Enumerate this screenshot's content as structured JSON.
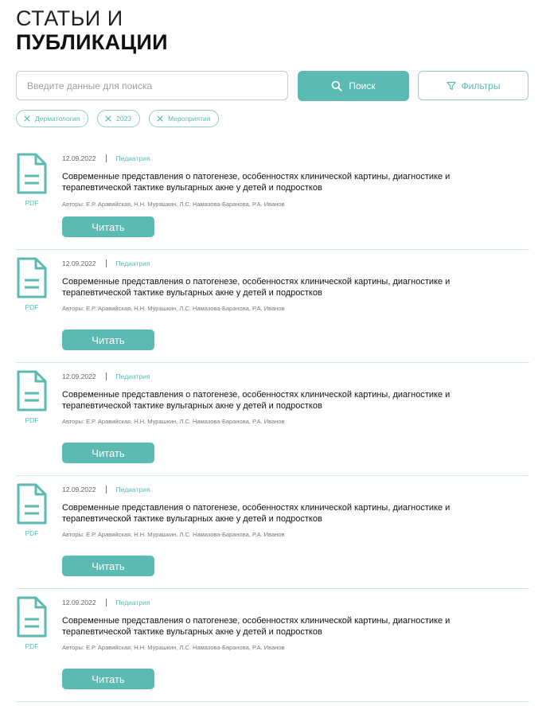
{
  "page": {
    "title_line1": "СТАТЬИ И",
    "title_line2": "ПУБЛИКАЦИИ"
  },
  "search": {
    "placeholder": "Введите данные для поиска",
    "button_label": "Поиск",
    "filters_label": "Фильтры",
    "search_icon": "search-icon",
    "filter_icon": "funnel-icon"
  },
  "chips": [
    {
      "label": "Дерматология"
    },
    {
      "label": "2023"
    },
    {
      "label": "Мероприятия"
    }
  ],
  "colors": {
    "accent": "#5bbab1",
    "accent_light": "#8fd0ca",
    "divider": "#cfe9e6"
  },
  "articles": [
    {
      "date": "12.09.2022",
      "category": "Педиатрия",
      "title": "Современные представления о патогенезе, особенностях клинической картины, диагностике и терапевтической тактике вульгарных акне у детей и подростков",
      "authors": "Авторы: Е.Р. Аравийская, Н.Н. Мурашкин, Л.С. Намазова-Баранова, Р.А. Иванов",
      "file_type": "PDF",
      "read_label": "Читать"
    },
    {
      "date": "12.09.2022",
      "category": "Педиатрия",
      "title": "Современные представления о патогенезе, особенностях клинической картины, диагностике и терапевтической тактике вульгарных акне у детей и подростков",
      "authors": "Авторы: Е.Р. Аравийская, Н.Н. Мурашкин, Л.С. Намазова-Баранова, Р.А. Иванов",
      "file_type": "PDF",
      "read_label": "Читать"
    },
    {
      "date": "12.09.2022",
      "category": "Педиатрия",
      "title": "Современные представления о патогенезе, особенностях клинической картины, диагностике и терапевтической тактике вульгарных акне у детей и подростков",
      "authors": "Авторы: Е.Р. Аравийская, Н.Н. Мурашкин, Л.С. Намазова-Баранова, Р.А. Иванов",
      "file_type": "PDF",
      "read_label": "Читать"
    },
    {
      "date": "12.09.2022",
      "category": "Педиатрия",
      "title": "Современные представления о патогенезе, особенностях клинической картины, диагностике и терапевтической тактике вульгарных акне у детей и подростков",
      "authors": "Авторы: Е.Р. Аравийская, Н.Н. Мурашкин, Л.С. Намазова-Баранова, Р.А. Иванов",
      "file_type": "PDF",
      "read_label": "Читать"
    },
    {
      "date": "12.09.2022",
      "category": "Педиатрия",
      "title": "Современные представления о патогенезе, особенностях клинической картины, диагностике и терапевтической тактике вульгарных акне у детей и подростков",
      "authors": "Авторы: Е.Р. Аравийская, Н.Н. Мурашкин, Л.С. Намазова-Баранова, Р.А. Иванов",
      "file_type": "PDF",
      "read_label": "Читать"
    }
  ]
}
